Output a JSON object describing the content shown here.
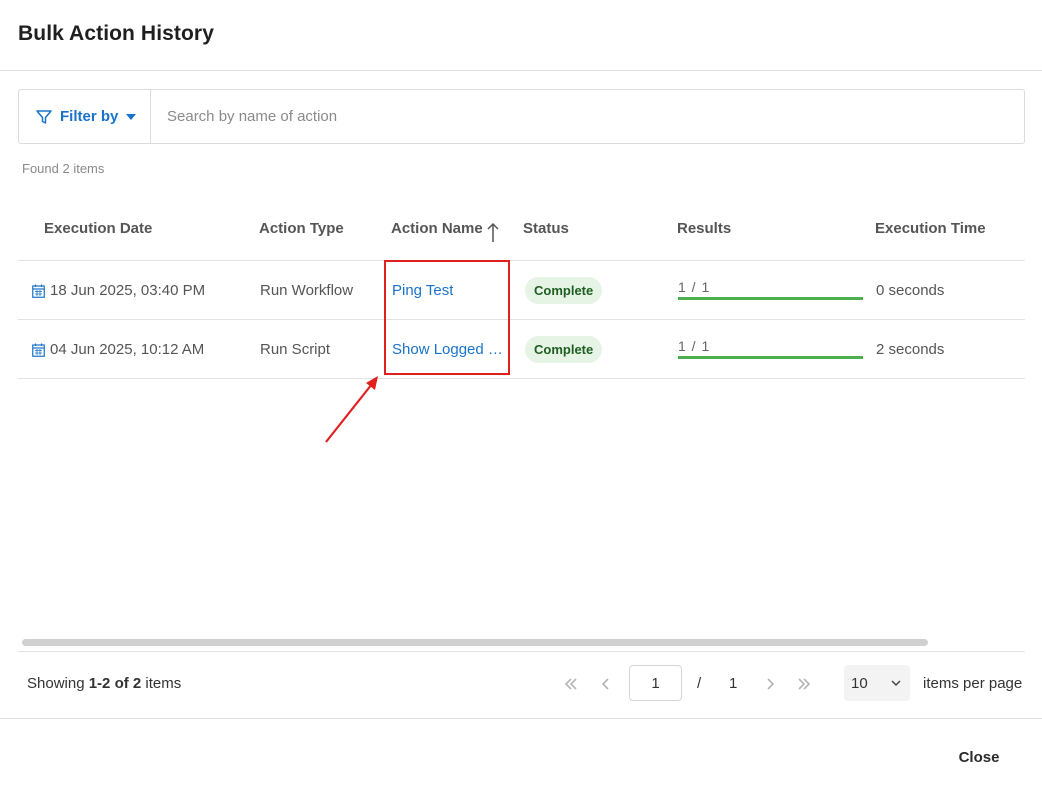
{
  "dialog": {
    "title": "Bulk Action History",
    "close_label": "Close"
  },
  "toolbar": {
    "filter_label": "Filter by",
    "search_placeholder": "Search by name of action",
    "search_value": ""
  },
  "found_text": "Found 2 items",
  "table": {
    "columns": [
      "Execution Date",
      "Action Type",
      "Action Name",
      "Status",
      "Results",
      "Execution Time"
    ],
    "sort": {
      "column": "Action Name",
      "direction": "ascending"
    },
    "rows": [
      {
        "date": "18 Jun 2025, 03:40 PM",
        "type": "Run Workflow",
        "name": "Ping Test",
        "status": "Complete",
        "results": "1 / 1",
        "results_fraction": 1.0,
        "time": "0 seconds"
      },
      {
        "date": "04 Jun 2025, 10:12 AM",
        "type": "Run Script",
        "name": "Show Logged i…",
        "status": "Complete",
        "results": "1 / 1",
        "results_fraction": 1.0,
        "time": "2 seconds"
      }
    ]
  },
  "pagination": {
    "showing_prefix": "Showing ",
    "showing_range": "1-2 of 2",
    "showing_suffix": " items",
    "current_page": "1",
    "slash": "/",
    "total_pages": "1",
    "per_page": "10",
    "per_page_label": "items per page"
  },
  "colors": {
    "link": "#1a73c9",
    "status_bg": "#e6f4e6",
    "status_text": "#1e5e21",
    "progress": "#4caf50",
    "annotation": "#e0201e"
  },
  "icons": {
    "filter": "funnel-icon",
    "date": "calendar-icon",
    "sort": "arrow-up-icon",
    "first": "double-chevron-left-icon",
    "prev": "chevron-left-icon",
    "next": "chevron-right-icon",
    "last": "double-chevron-right-icon",
    "dropdown": "chevron-down-icon"
  }
}
